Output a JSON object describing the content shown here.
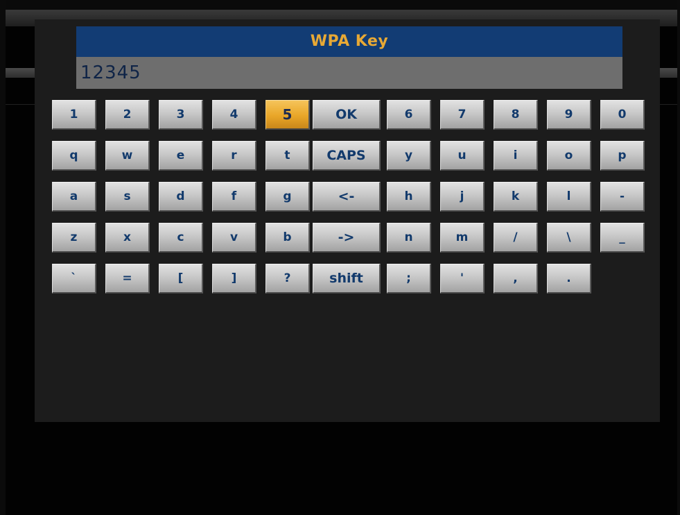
{
  "dialog": {
    "title": "WPA Key",
    "value": "12345"
  },
  "colors": {
    "title_bar": "#123c74",
    "title_text": "#e8a935",
    "input_bg": "#6e6e6e",
    "key_text": "#123a6c",
    "selected_key": "#e9a628",
    "dialog_bg": "#1c1c1c"
  },
  "keyboard": {
    "selected": "5",
    "rows": [
      [
        "1",
        "2",
        "3",
        "4",
        "5",
        "OK",
        "6",
        "7",
        "8",
        "9",
        "0"
      ],
      [
        "q",
        "w",
        "e",
        "r",
        "t",
        "CAPS",
        "y",
        "u",
        "i",
        "o",
        "p"
      ],
      [
        "a",
        "s",
        "d",
        "f",
        "g",
        "<-",
        "h",
        "j",
        "k",
        "l",
        "-"
      ],
      [
        "z",
        "x",
        "c",
        "v",
        "b",
        "->",
        "n",
        "m",
        "/",
        "\\",
        "_"
      ],
      [
        "`",
        "=",
        "[",
        "]",
        "?",
        "shift",
        ";",
        "'",
        ",",
        "."
      ]
    ],
    "key_names": [
      [
        "key-1",
        "key-2",
        "key-3",
        "key-4",
        "key-5",
        "ok-button",
        "key-6",
        "key-7",
        "key-8",
        "key-9",
        "key-0"
      ],
      [
        "key-q",
        "key-w",
        "key-e",
        "key-r",
        "key-t",
        "caps-button",
        "key-y",
        "key-u",
        "key-i",
        "key-o",
        "key-p"
      ],
      [
        "key-a",
        "key-s",
        "key-d",
        "key-f",
        "key-g",
        "backspace-button",
        "key-h",
        "key-j",
        "key-k",
        "key-l",
        "key-minus"
      ],
      [
        "key-z",
        "key-x",
        "key-c",
        "key-v",
        "key-b",
        "forward-button",
        "key-n",
        "key-m",
        "key-slash",
        "key-backslash",
        "key-underscore"
      ],
      [
        "key-backtick",
        "key-equals",
        "key-open-bracket",
        "key-close-bracket",
        "key-question",
        "shift-button",
        "key-semicolon",
        "key-apostrophe",
        "key-comma",
        "key-period"
      ]
    ]
  }
}
